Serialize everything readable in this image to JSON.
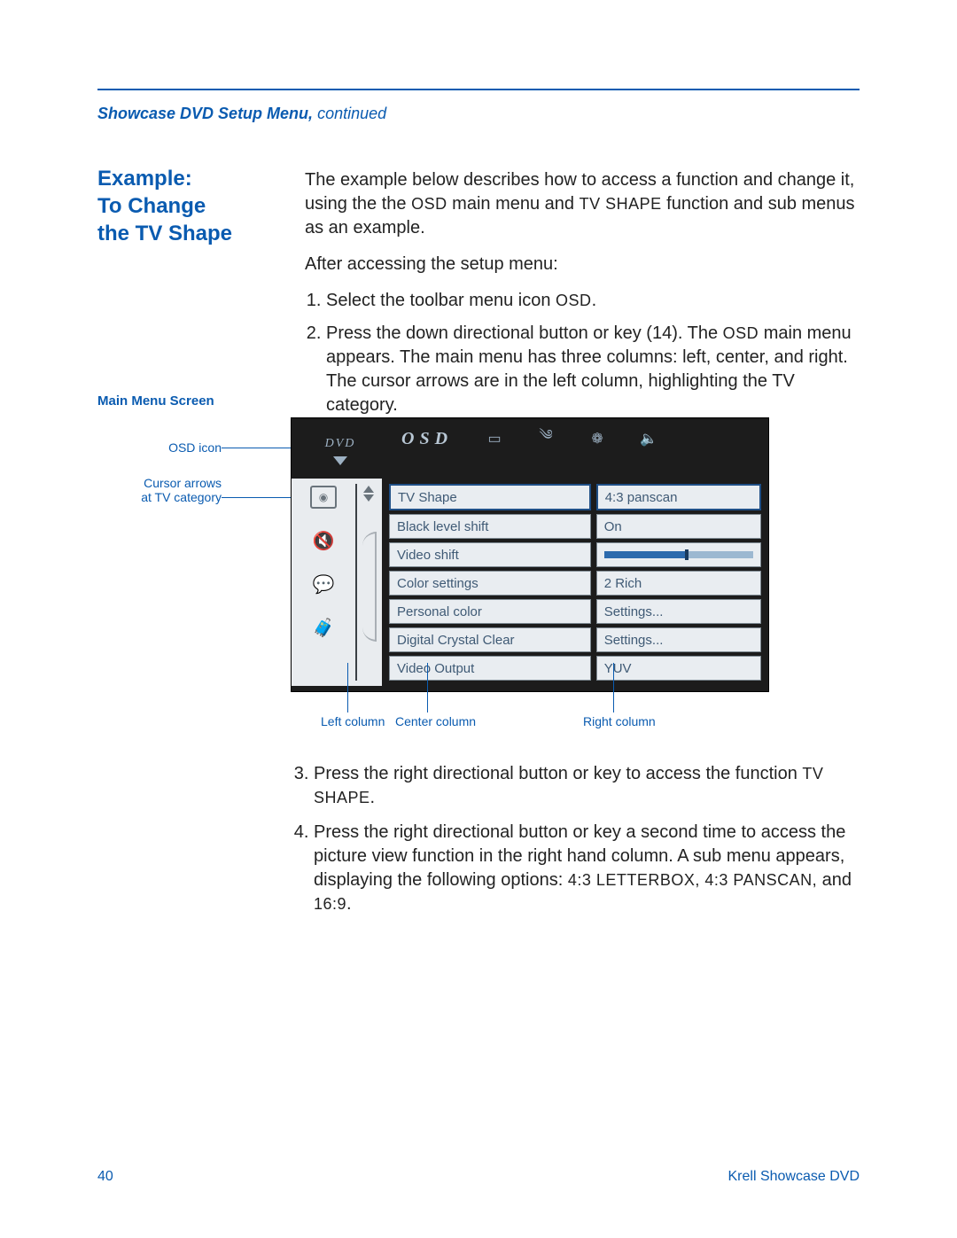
{
  "header": {
    "section": "Showcase DVD Setup Menu,",
    "continued": " continued"
  },
  "example": {
    "heading1": "Example:",
    "heading2": "To Change",
    "heading3": "the TV Shape"
  },
  "body": {
    "intro1": "The example below describes how to access a function and change it, using the the ",
    "osd_sc": "OSD",
    "intro2": " main menu and ",
    "tvshape_sc": "TV SHAPE",
    "intro3": " function and sub menus as an example.",
    "after_access": "After accessing the setup menu:",
    "step1_a": "Select the toolbar menu icon ",
    "step1_b": "OSD",
    "step1_c": ".",
    "step2_a": "Press the down directional button or key (14). The ",
    "step2_b": "OSD",
    "step2_c": " main menu appears. The main menu has three columns: left, center, and right. The cursor arrows are in the left column, highlighting the TV category."
  },
  "figure": {
    "title": "Main Menu Screen",
    "callout_osd": "OSD icon",
    "callout_cursor": "Cursor arrows at TV category",
    "osd_label": "OSD",
    "dvd_logo": "DVD",
    "options": [
      "TV Shape",
      "Black level shift",
      "Video shift",
      "Color settings",
      "Personal color",
      "Digital Crystal Clear",
      "Video Output"
    ],
    "values": [
      "4:3 panscan",
      "On",
      "__slider__",
      "2 Rich",
      "Settings...",
      "Settings...",
      "YUV"
    ],
    "bottom": {
      "left": "Left column",
      "center": "Center column",
      "right": "Right column"
    }
  },
  "after": {
    "step3_a": "Press the right directional button or key to access the function ",
    "step3_b": "TV SHAPE",
    "step3_c": ".",
    "step4_a": "Press the right directional button or key a second time to access the picture view function in the right hand column. A sub menu appears, displaying the following options: ",
    "step4_b": "4:3 LETTERBOX, 4:3 PANSCAN,",
    "step4_c": " and ",
    "step4_d": "16:9",
    "step4_e": "."
  },
  "footer": {
    "page": "40",
    "product": "Krell Showcase DVD"
  }
}
